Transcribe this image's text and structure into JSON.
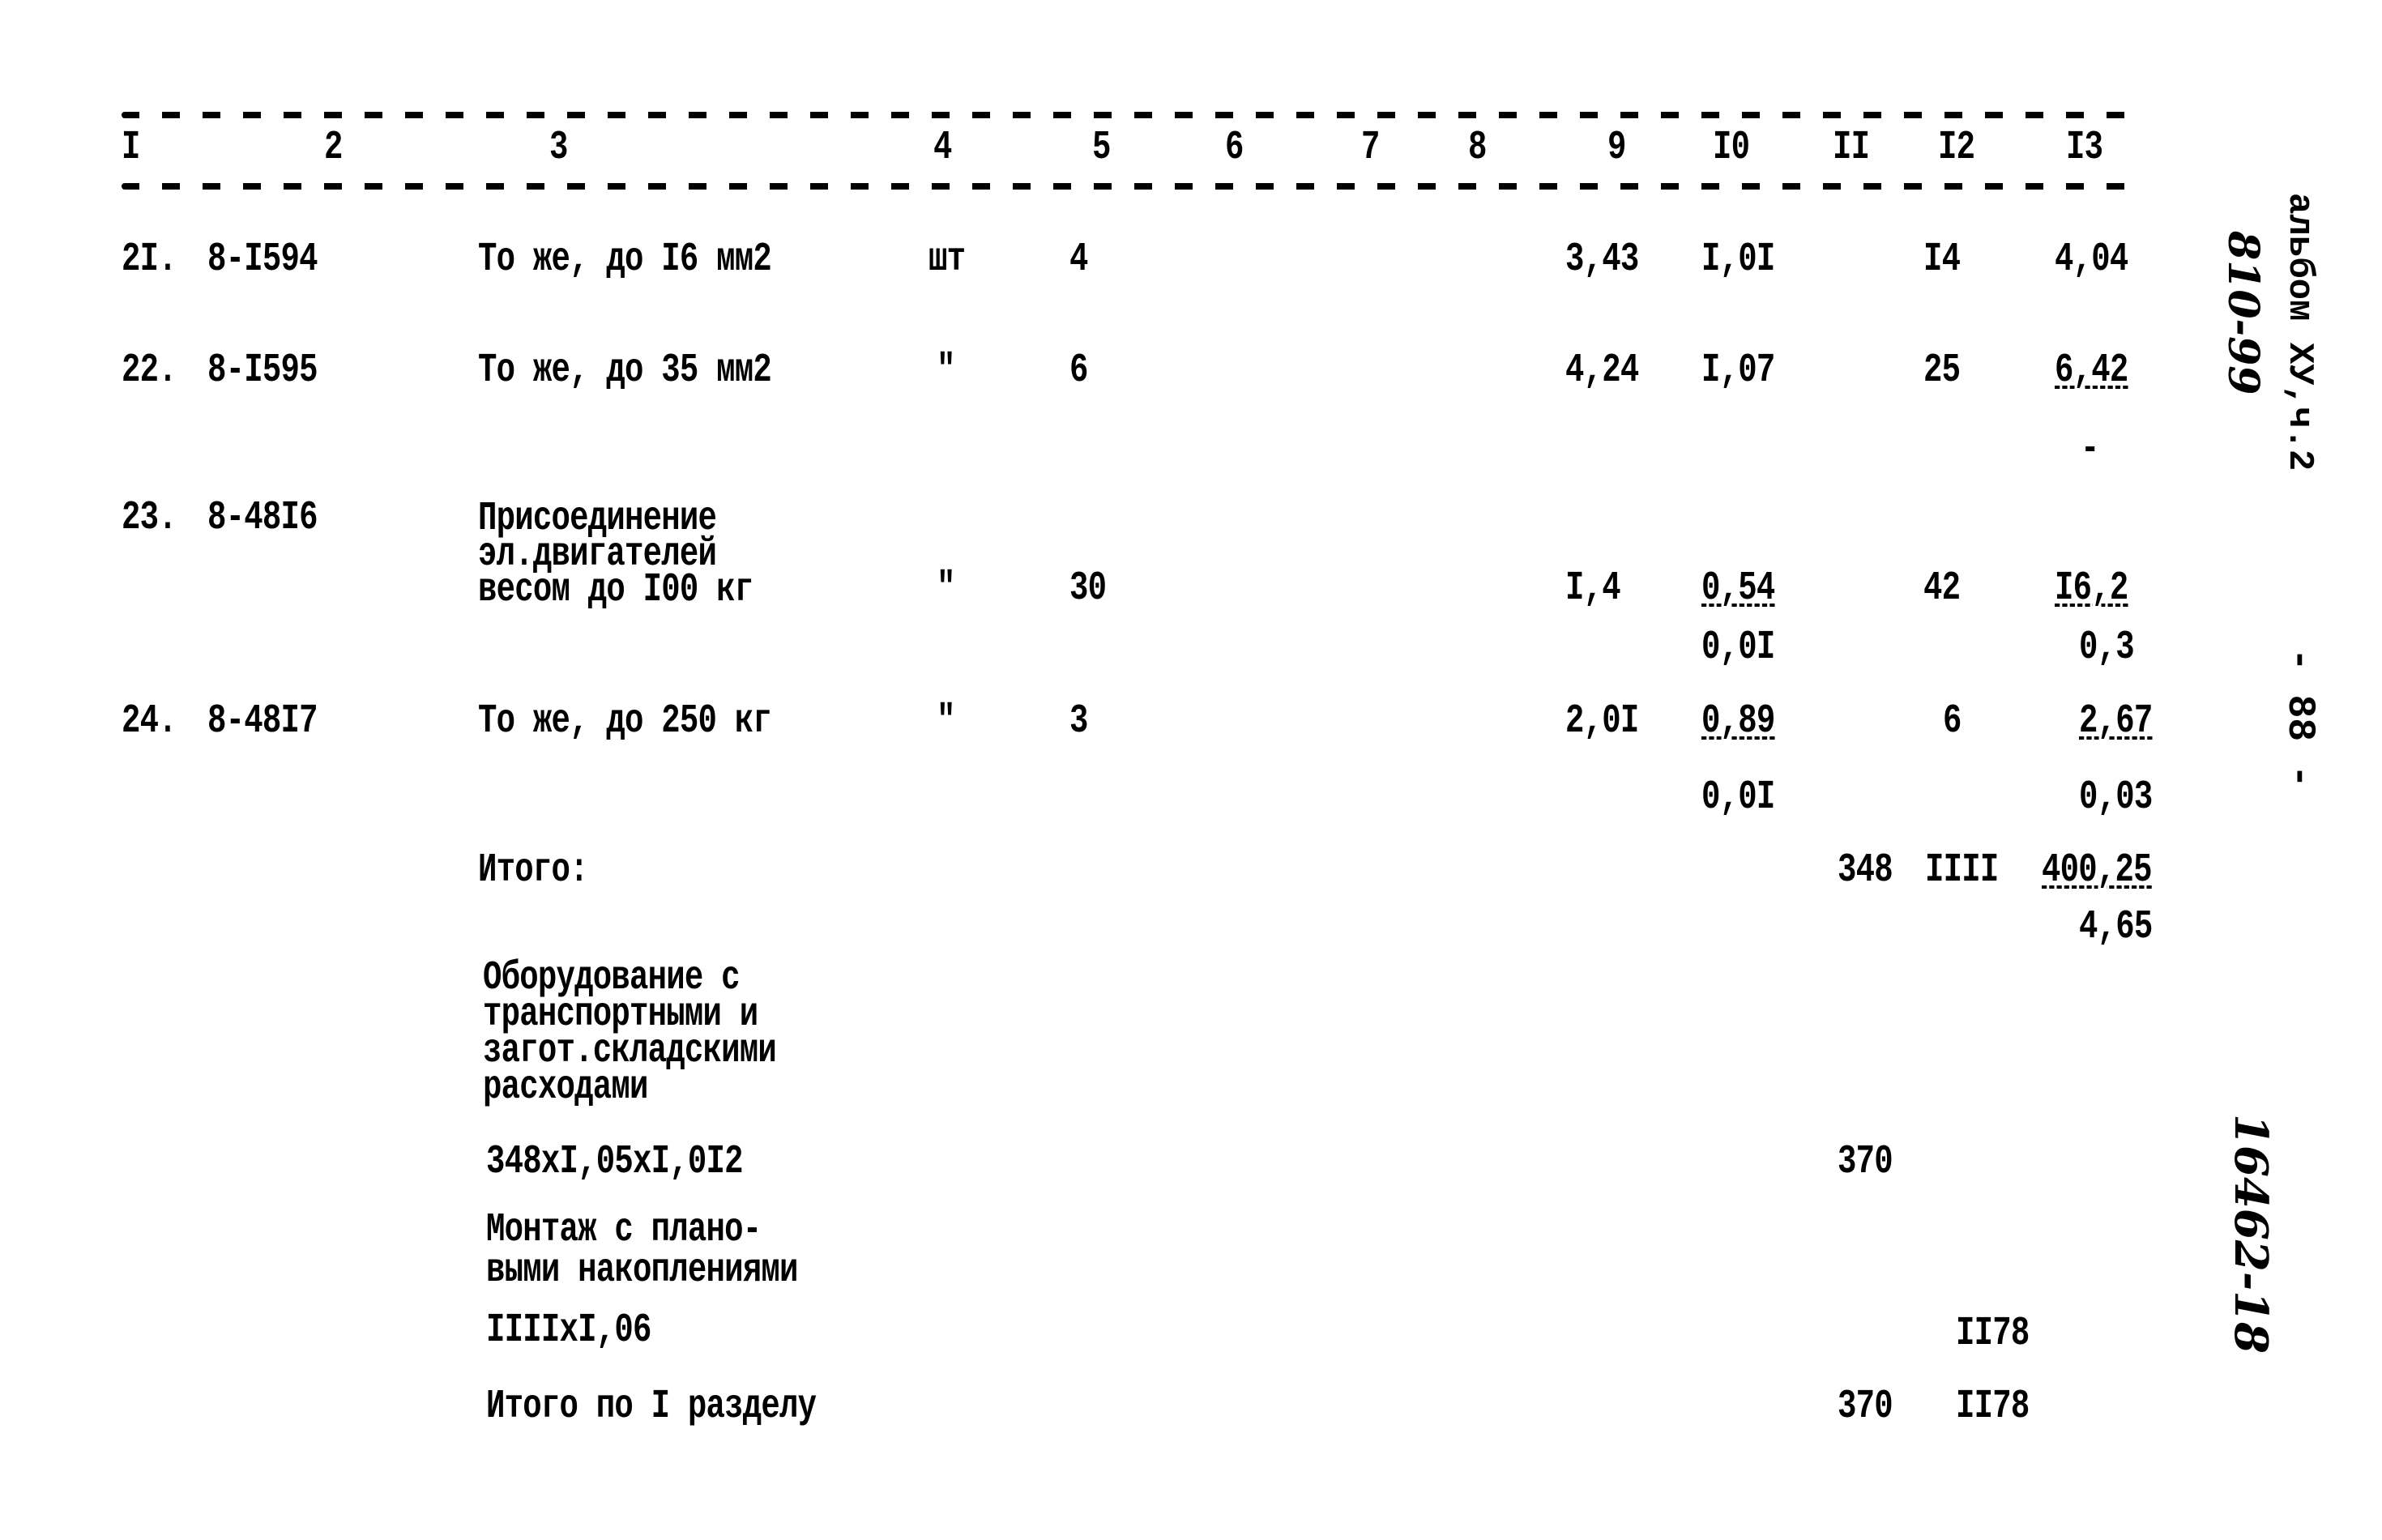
{
  "header": {
    "columns": [
      "I",
      "2",
      "3",
      "4",
      "5",
      "6",
      "7",
      "8",
      "9",
      "I0",
      "II",
      "I2",
      "I3"
    ]
  },
  "rows": [
    {
      "num": "2I.",
      "code": "8-I594",
      "name": "То же, до I6 мм2",
      "unit": "шт",
      "qty": "4",
      "c9": "3,43",
      "c10": "I,0I",
      "c10_sub": "",
      "c12": "I4",
      "c13": "4,04",
      "c13_sub": ""
    },
    {
      "num": "22.",
      "code": "8-I595",
      "name": "То же, до 35 мм2",
      "unit": "\"",
      "qty": "6",
      "c9": "4,24",
      "c10": "I,07",
      "c10_sub": "",
      "c12": "25",
      "c13": "6,42",
      "c13_sub": "-"
    },
    {
      "num": "23.",
      "code": "8-48I6",
      "name_lines": [
        "Присоединение",
        "эл.двигателей",
        "весом до I00 кг"
      ],
      "unit": "\"",
      "qty": "30",
      "c9": "I,4",
      "c10": "0,54",
      "c10_sub": "0,0I",
      "c12": "42",
      "c13": "I6,2",
      "c13_sub": "0,3"
    },
    {
      "num": "24.",
      "code": "8-48I7",
      "name": "То же, до 250 кг",
      "unit": "\"",
      "qty": "3",
      "c9": "2,0I",
      "c10": "0,89",
      "c10_sub": "0,0I",
      "c12": "6",
      "c13": "2,67",
      "c13_sub": "0,03"
    }
  ],
  "totals": {
    "itogo_label": "Итого:",
    "itogo_c11": "348",
    "itogo_c12": "IIII",
    "itogo_c13": "400,25",
    "itogo_c13_sub": "4,65",
    "equipment_lines": [
      "Оборудование с",
      "транспортными и",
      "загот.складскими",
      "расходами"
    ],
    "equipment_formula": "348xI,05xI,0I2",
    "equipment_c11": "370",
    "montage_lines": [
      "Монтаж с плано-",
      "выми накоплениями"
    ],
    "montage_formula": "IIIIxI,06",
    "montage_c12": "II78",
    "section_total_label": "Итого по I разделу",
    "section_total_c11": "370",
    "section_total_c12": "II78"
  },
  "margin": {
    "album_ref": "альбом XУ,ч.2",
    "handwritten_ref": "810-99",
    "page_number": "- 88 -",
    "doc_number": "16462-18"
  }
}
